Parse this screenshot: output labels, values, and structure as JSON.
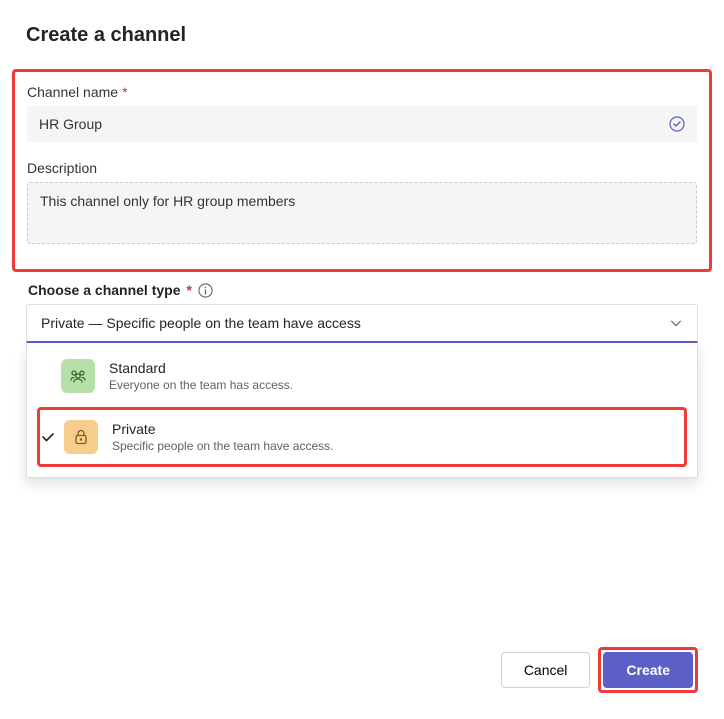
{
  "dialog_title": "Create a channel",
  "name_label": "Channel name",
  "name_value": "HR Group",
  "desc_label": "Description",
  "desc_value": "This channel only for HR group members",
  "type_label": "Choose a channel type",
  "type_selected": "Private — Specific people on the team have access",
  "options": [
    {
      "title": "Standard",
      "sub": "Everyone on the team has access."
    },
    {
      "title": "Private",
      "sub": "Specific people on the team have access."
    }
  ],
  "buttons": {
    "cancel": "Cancel",
    "create": "Create"
  }
}
